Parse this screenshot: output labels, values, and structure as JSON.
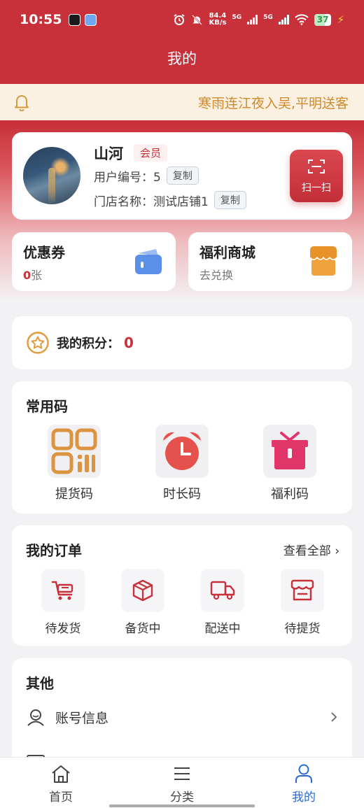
{
  "status_bar": {
    "time": "10:55",
    "speed_value": "84.4",
    "speed_unit": "KB/s",
    "net1": "5G",
    "net2": "5G",
    "battery": "37"
  },
  "header": {
    "title": "我的"
  },
  "notice": {
    "text": "寒雨连江夜入吴,平明送客"
  },
  "profile": {
    "name": "山河",
    "badge": "会员",
    "user_id_label": "用户编号：",
    "user_id": "5",
    "store_label": "门店名称：",
    "store_name": "测试店铺1",
    "copy_label": "复制",
    "scan_label": "扫一扫"
  },
  "coupons": {
    "title": "优惠券",
    "count": "0",
    "unit": "张"
  },
  "welfare_mall": {
    "title": "福利商城",
    "sub": "去兑换"
  },
  "points": {
    "label": "我的积分：",
    "value": "0"
  },
  "codes": {
    "title": "常用码",
    "items": [
      {
        "label": "提货码",
        "icon": "qr-code-icon"
      },
      {
        "label": "时长码",
        "icon": "alarm-clock-icon"
      },
      {
        "label": "福利码",
        "icon": "gift-box-icon"
      }
    ]
  },
  "orders": {
    "title": "我的订单",
    "see_all": "查看全部",
    "items": [
      {
        "label": "待发货",
        "icon": "cart-icon"
      },
      {
        "label": "备货中",
        "icon": "package-icon"
      },
      {
        "label": "配送中",
        "icon": "truck-icon"
      },
      {
        "label": "待提货",
        "icon": "store-icon"
      }
    ]
  },
  "other": {
    "title": "其他",
    "items": [
      {
        "label": "账号信息",
        "icon": "user-icon"
      }
    ]
  },
  "tabbar": {
    "items": [
      {
        "label": "首页",
        "icon": "home-icon"
      },
      {
        "label": "分类",
        "icon": "menu-icon"
      },
      {
        "label": "我的",
        "icon": "profile-icon"
      }
    ]
  },
  "colors": {
    "brand": "#c8303a",
    "accent_blue": "#2a6ad1",
    "notice_text": "#d08a2a"
  }
}
